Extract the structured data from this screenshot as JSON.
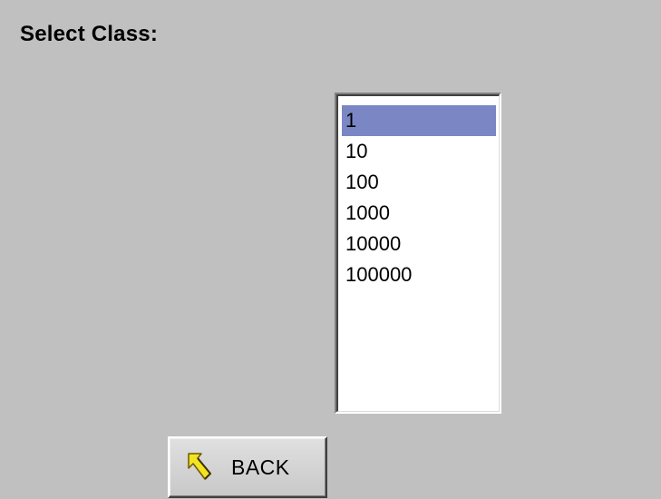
{
  "page": {
    "title": "Select Class:"
  },
  "class_list": {
    "selected_index": 0,
    "items": [
      {
        "label": "1"
      },
      {
        "label": "10"
      },
      {
        "label": "100"
      },
      {
        "label": "1000"
      },
      {
        "label": "10000"
      },
      {
        "label": "100000"
      }
    ]
  },
  "back_button": {
    "label": "BACK",
    "icon": "back-arrow-icon"
  },
  "colors": {
    "background": "#c0c0c0",
    "selection": "#7b86c4",
    "icon_fill": "#f4e322"
  }
}
